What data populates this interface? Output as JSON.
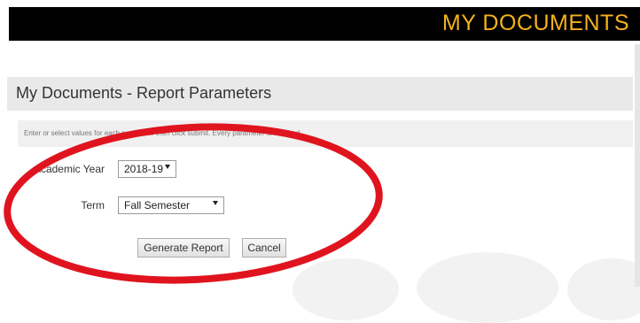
{
  "header": {
    "title": "MY DOCUMENTS"
  },
  "panel": {
    "title": "My Documents - Report Parameters",
    "instruction": "Enter or select values for each parameter then click submit. Every parameter is required."
  },
  "fields": {
    "academic_year": {
      "label": "Academic Year",
      "value": "2018-19"
    },
    "term": {
      "label": "Term",
      "value": "Fall Semester"
    }
  },
  "buttons": {
    "generate": "Generate Report",
    "cancel": "Cancel"
  },
  "colors": {
    "header_bg": "#000000",
    "header_text": "#f5b21b",
    "annotation": "#e0141e"
  }
}
